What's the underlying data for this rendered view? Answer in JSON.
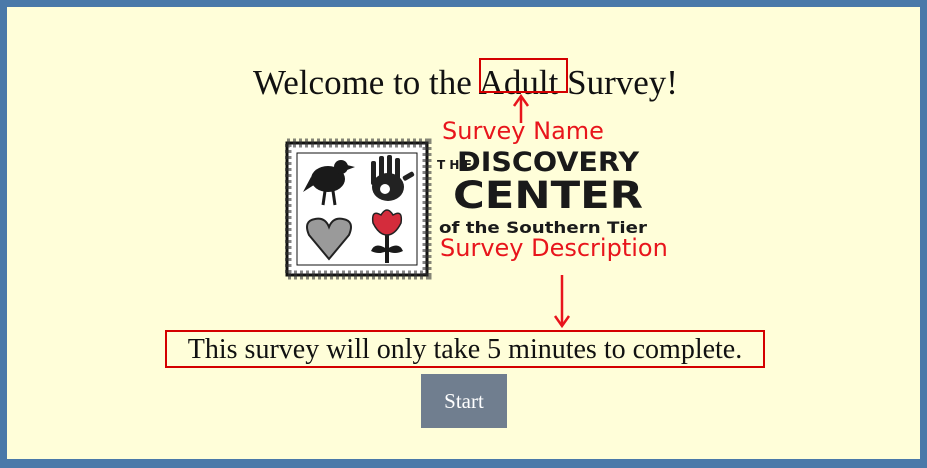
{
  "header": {
    "title_prefix": "Welcome to the ",
    "survey_name": "Adult",
    "title_suffix": " Survey!"
  },
  "annotations": {
    "survey_name_label": "Survey Name",
    "survey_description_label": "Survey Description"
  },
  "logo": {
    "line_the_top": "T H E",
    "line1": "DISCOVERY",
    "line2": "CENTER",
    "line3": "of the Southern Tier"
  },
  "survey": {
    "description": "This survey will only take 5 minutes to complete."
  },
  "actions": {
    "start_label": "Start"
  },
  "colors": {
    "page_border": "#4a79a9",
    "background": "#fffed9",
    "annotation_red": "#e8151c",
    "button": "#707e8f"
  }
}
